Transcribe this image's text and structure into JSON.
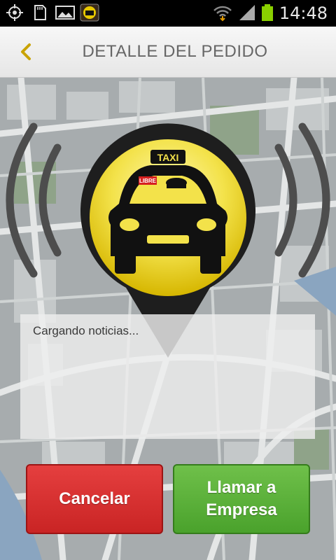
{
  "status_bar": {
    "time": "14:48",
    "icons": [
      "gps-icon",
      "sd-card-icon",
      "gallery-icon",
      "taxi-app-icon",
      "wifi-icon",
      "signal-icon",
      "battery-icon"
    ]
  },
  "header": {
    "title": "DETALLE DEL PEDIDO",
    "back_icon": "chevron-left-icon"
  },
  "taxi_marker": {
    "roof_sign": "TAXI",
    "plate": "LIBRE"
  },
  "news": {
    "text": "Cargando noticias..."
  },
  "buttons": {
    "cancel_label": "Cancelar",
    "call_line1": "Llamar a",
    "call_line2": "Empresa"
  },
  "colors": {
    "accent": "#d4a800",
    "marker_yellow": "#f3e24a",
    "cancel_red": "#d63131",
    "call_green": "#5bb13a"
  }
}
